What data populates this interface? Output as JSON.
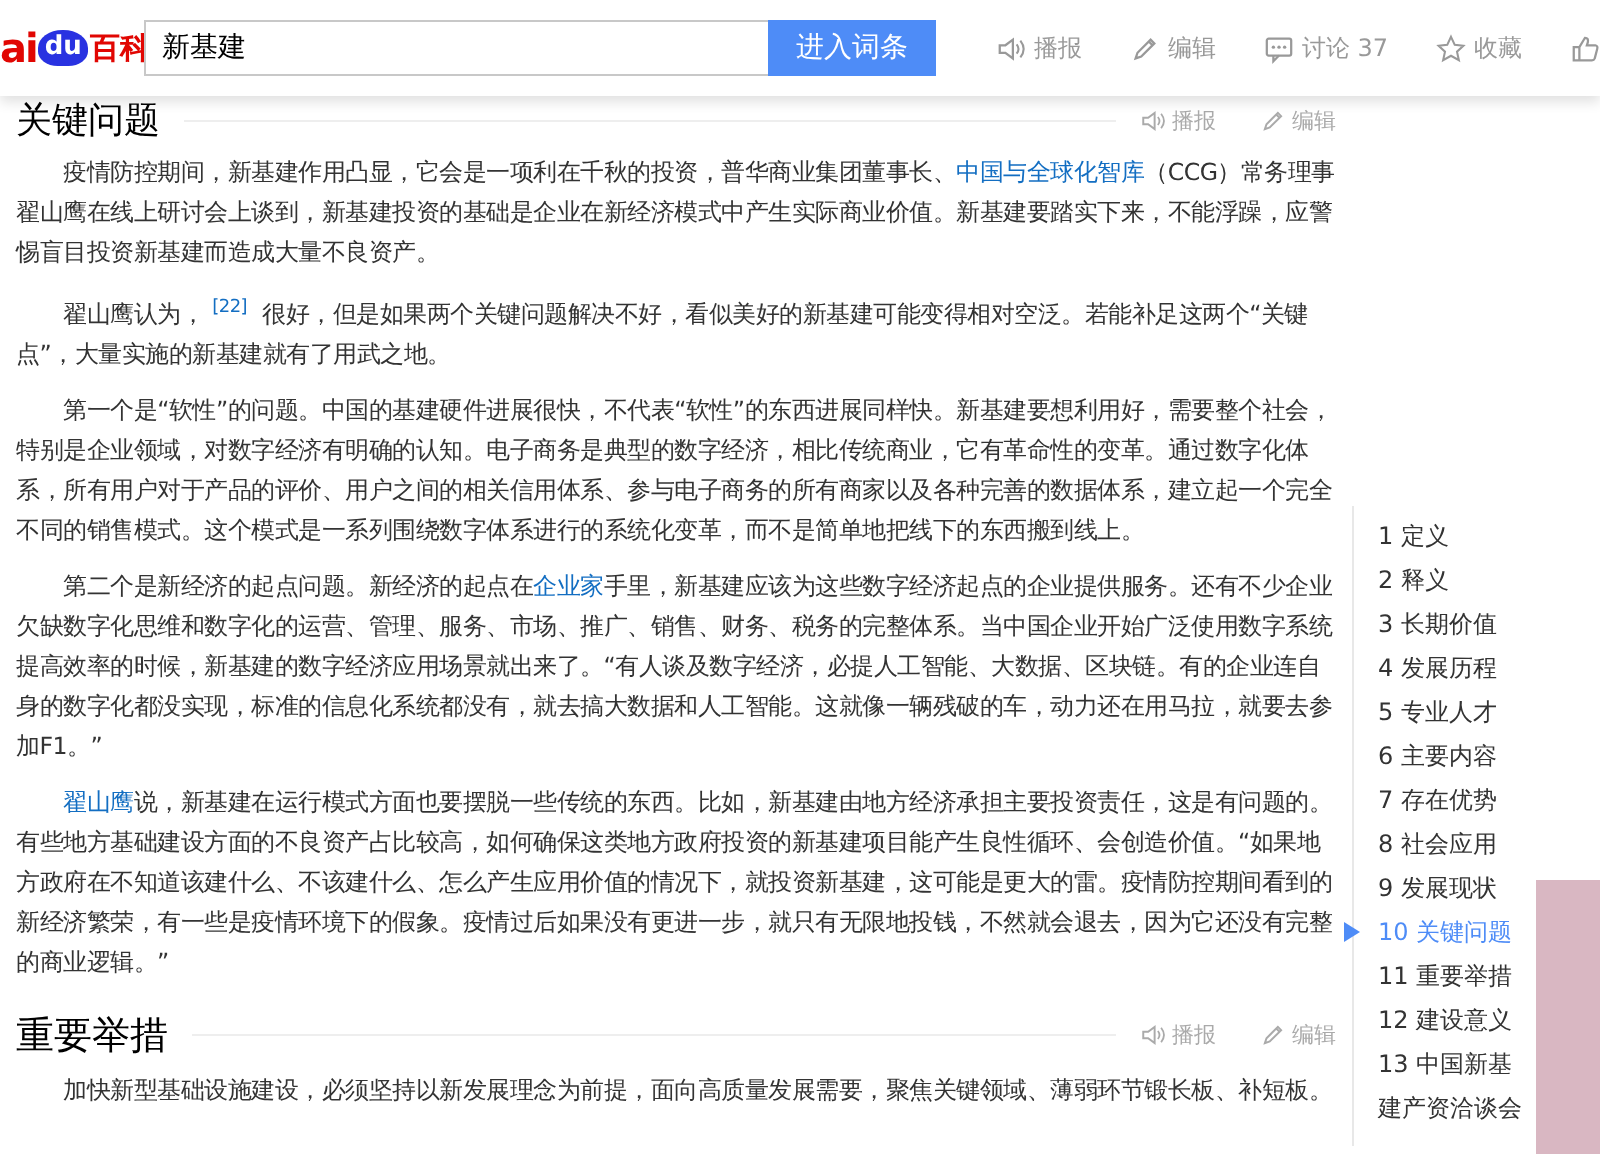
{
  "header": {
    "logo": {
      "text_1": "ai",
      "paw_text": "du",
      "text_2": "百科"
    },
    "search": {
      "value": "新基建"
    },
    "search_button": "进入词条",
    "actions": [
      {
        "kind": "speaker",
        "label": "播报"
      },
      {
        "kind": "pencil",
        "label": "编辑"
      },
      {
        "kind": "comment",
        "label": "讨论 37"
      },
      {
        "kind": "star",
        "label": "收藏"
      },
      {
        "kind": "thumb"
      }
    ]
  },
  "sections": [
    {
      "title": "关键问题",
      "tools": [
        {
          "kind": "speaker",
          "label": "播报"
        },
        {
          "kind": "pencil",
          "label": "编辑"
        }
      ],
      "paragraphs": [
        [
          {
            "kind": "text",
            "text": "疫情防控期间，新基建作用凸显，它会是一项利在千秋的投资，普华商业集团董事长、"
          },
          {
            "kind": "link",
            "text": "中国与全球化智库"
          },
          {
            "kind": "text",
            "text": "（CCG）常务理事翟山鹰在线上研讨会上谈到，新基建投资的基础是企业在新经济模式中产生实际商业价值。新基建要踏实下来，不能浮躁，应警惕盲目投资新基建而造成大量不良资产。"
          }
        ],
        [
          {
            "kind": "text",
            "text": "翟山鹰认为，"
          },
          {
            "kind": "ref",
            "text": "[22]"
          },
          {
            "kind": "text",
            "text": " 很好，但是如果两个关键问题解决不好，看似美好的新基建可能变得相对空泛。若能补足这两个“关键点”，大量实施的新基建就有了用武之地。"
          }
        ],
        [
          {
            "kind": "text",
            "text": "第一个是“软性”的问题。中国的基建硬件进展很快，不代表“软性”的东西进展同样快。新基建要想利用好，需要整个社会，特别是企业领域，对数字经济有明确的认知。电子商务是典型的数字经济，相比传统商业，它有革命性的变革。通过数字化体系，所有用户对于产品的评价、用户之间的相关信用体系、参与电子商务的所有商家以及各种完善的数据体系，建立起一个完全不同的销售模式。这个模式是一系列围绕数字体系进行的系统化变革，而不是简单地把线下的东西搬到线上。"
          }
        ],
        [
          {
            "kind": "text",
            "text": "第二个是新经济的起点问题。新经济的起点在"
          },
          {
            "kind": "link",
            "text": "企业家"
          },
          {
            "kind": "text",
            "text": "手里，新基建应该为这些数字经济起点的企业提供服务。还有不少企业欠缺数字化思维和数字化的运营、管理、服务、市场、推广、销售、财务、税务的完整体系。当中国企业开始广泛使用数字系统提高效率的时候，新基建的数字经济应用场景就出来了。“有人谈及数字经济，必提人工智能、大数据、区块链。有的企业连自身的数字化都没实现，标准的信息化系统都没有，就去搞大数据和人工智能。这就像一辆残破的车，动力还在用马拉，就要去参加F1。”"
          }
        ],
        [
          {
            "kind": "link",
            "text": "翟山鹰"
          },
          {
            "kind": "text",
            "text": "说，新基建在运行模式方面也要摆脱一些传统的东西。比如，新基建由地方经济承担主要投资责任，这是有问题的。有些地方基础建设方面的不良资产占比较高，如何确保这类地方政府投资的新基建项目能产生良性循环、会创造价值。“如果地方政府在不知道该建什么、不该建什么、怎么产生应用价值的情况下，就投资新基建，这可能是更大的雷。疫情防控期间看到的新经济繁荣，有一些是疫情环境下的假象。疫情过后如果没有更进一步，就只有无限地投钱，不然就会退去，因为它还没有完整的商业逻辑。”"
          }
        ]
      ]
    },
    {
      "title": "重要举措",
      "tools": [
        {
          "kind": "speaker",
          "label": "播报"
        },
        {
          "kind": "pencil",
          "label": "编辑"
        }
      ],
      "paragraphs": [
        [
          {
            "kind": "text",
            "text": "加快新型基础设施建设，必须坚持以新发展理念为前提，面向高质量发展需要，聚焦关键领域、薄弱环节锻长板、补短板。"
          }
        ]
      ]
    }
  ],
  "toc": [
    {
      "number": "1",
      "label": "定义",
      "selected": false
    },
    {
      "number": "2",
      "label": "释义",
      "selected": false
    },
    {
      "number": "3",
      "label": "长期价值",
      "selected": false
    },
    {
      "number": "4",
      "label": "发展历程",
      "selected": false
    },
    {
      "number": "5",
      "label": "专业人才",
      "selected": false
    },
    {
      "number": "6",
      "label": "主要内容",
      "selected": false
    },
    {
      "number": "7",
      "label": "存在优势",
      "selected": false
    },
    {
      "number": "8",
      "label": "社会应用",
      "selected": false
    },
    {
      "number": "9",
      "label": "发展现状",
      "selected": false
    },
    {
      "number": "10",
      "label": "关键问题",
      "selected": true
    },
    {
      "number": "11",
      "label": "重要举措",
      "selected": false
    },
    {
      "number": "12",
      "label": "建设意义",
      "selected": false
    },
    {
      "number": "13",
      "label": "中国新基建产资洽谈会",
      "selected": false
    }
  ]
}
